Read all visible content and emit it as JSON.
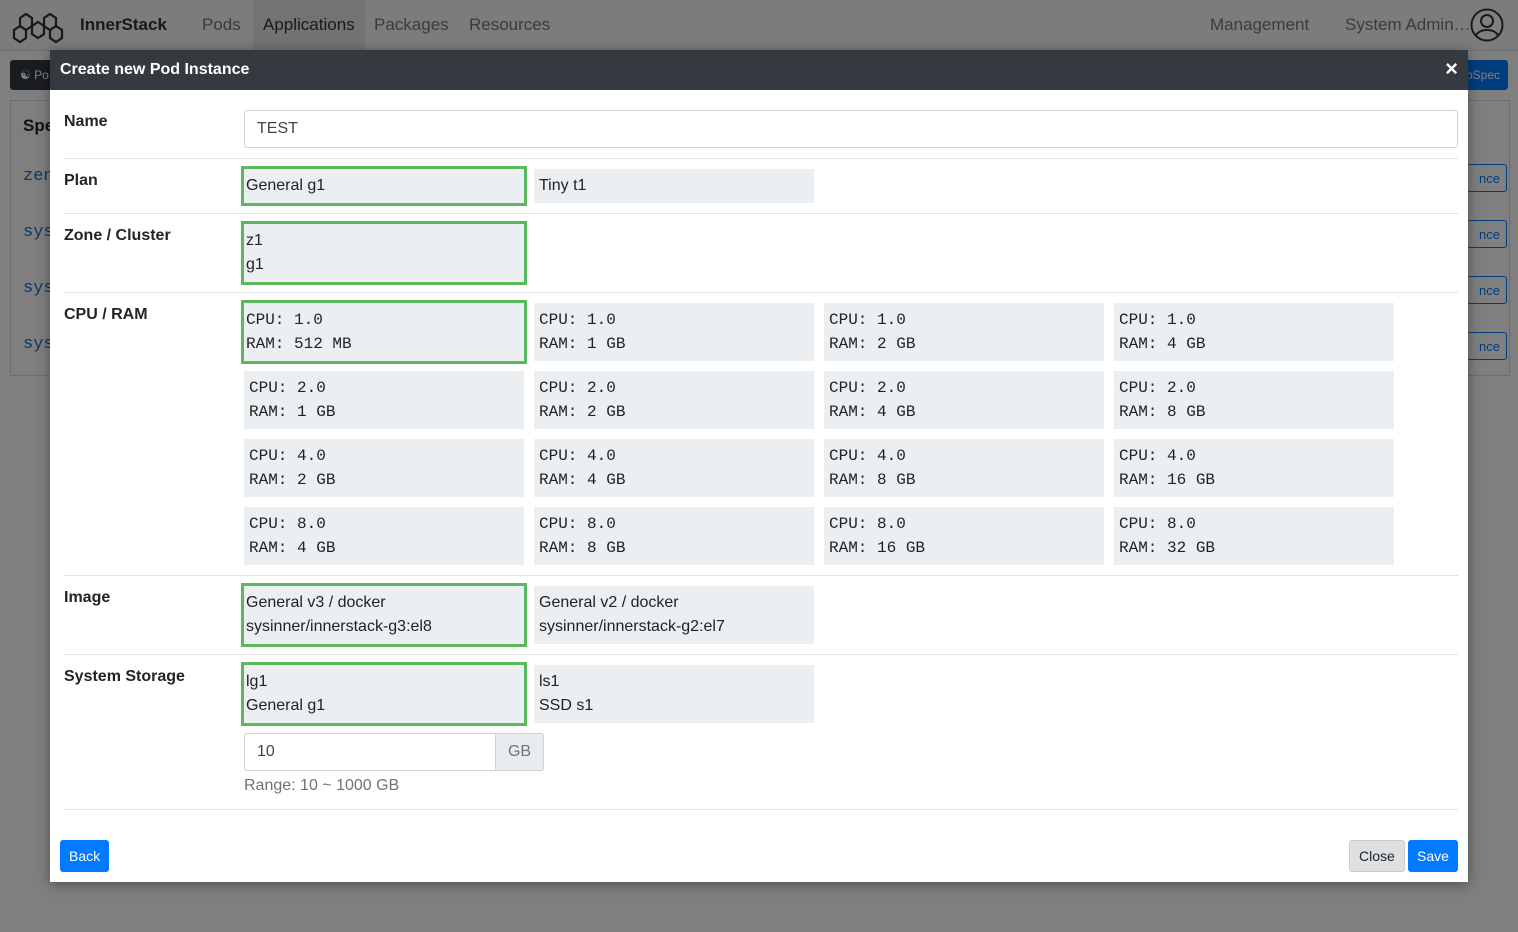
{
  "navbar": {
    "brand": "InnerStack",
    "links": [
      "Pods",
      "Applications",
      "Packages",
      "Resources"
    ],
    "right": [
      "Management",
      "System Admin…"
    ]
  },
  "background": {
    "bar_label": "Po",
    "right_button": "pSpec",
    "table_header": "Spe",
    "rows": [
      "zen",
      "sys",
      "sys",
      "sys"
    ],
    "row_button": "nce"
  },
  "modal": {
    "title": "Create new Pod Instance",
    "close_glyph": "×",
    "name": {
      "label": "Name",
      "value": "TEST"
    },
    "plan": {
      "label": "Plan",
      "options": [
        {
          "l1": "General g1",
          "selected": true
        },
        {
          "l1": "Tiny t1",
          "selected": false
        }
      ]
    },
    "zone": {
      "label": "Zone / Cluster",
      "options": [
        {
          "l1": "z1",
          "l2": "g1",
          "selected": true
        }
      ]
    },
    "cpu_ram": {
      "label": "CPU / RAM",
      "options": [
        {
          "l1": "CPU: 1.0",
          "l2": "RAM: 512 MB",
          "selected": true
        },
        {
          "l1": "CPU: 1.0",
          "l2": "RAM: 1 GB"
        },
        {
          "l1": "CPU: 1.0",
          "l2": "RAM: 2 GB"
        },
        {
          "l1": "CPU: 1.0",
          "l2": "RAM: 4 GB"
        },
        {
          "l1": "CPU: 2.0",
          "l2": "RAM: 1 GB"
        },
        {
          "l1": "CPU: 2.0",
          "l2": "RAM: 2 GB"
        },
        {
          "l1": "CPU: 2.0",
          "l2": "RAM: 4 GB"
        },
        {
          "l1": "CPU: 2.0",
          "l2": "RAM: 8 GB"
        },
        {
          "l1": "CPU: 4.0",
          "l2": "RAM: 2 GB"
        },
        {
          "l1": "CPU: 4.0",
          "l2": "RAM: 4 GB"
        },
        {
          "l1": "CPU: 4.0",
          "l2": "RAM: 8 GB"
        },
        {
          "l1": "CPU: 4.0",
          "l2": "RAM: 16 GB"
        },
        {
          "l1": "CPU: 8.0",
          "l2": "RAM: 4 GB"
        },
        {
          "l1": "CPU: 8.0",
          "l2": "RAM: 8 GB"
        },
        {
          "l1": "CPU: 8.0",
          "l2": "RAM: 16 GB"
        },
        {
          "l1": "CPU: 8.0",
          "l2": "RAM: 32 GB"
        }
      ]
    },
    "image": {
      "label": "Image",
      "options": [
        {
          "l1": "General v3 / docker",
          "l2": "sysinner/innerstack-g3:el8",
          "selected": true
        },
        {
          "l1": "General v2 / docker",
          "l2": "sysinner/innerstack-g2:el7"
        }
      ]
    },
    "storage": {
      "label": "System Storage",
      "options": [
        {
          "l1": "lg1",
          "l2": "General g1",
          "selected": true
        },
        {
          "l1": "ls1",
          "l2": "SSD s1"
        }
      ],
      "size_value": "10",
      "size_unit": "GB",
      "range_hint": "Range: 10 ~ 1000 GB"
    },
    "footer": {
      "back": "Back",
      "close": "Close",
      "save": "Save"
    }
  },
  "colors": {
    "accent": "#007bff",
    "selected_border": "#5cb85c",
    "header_bg": "#343a40",
    "option_bg": "#eceff1"
  }
}
